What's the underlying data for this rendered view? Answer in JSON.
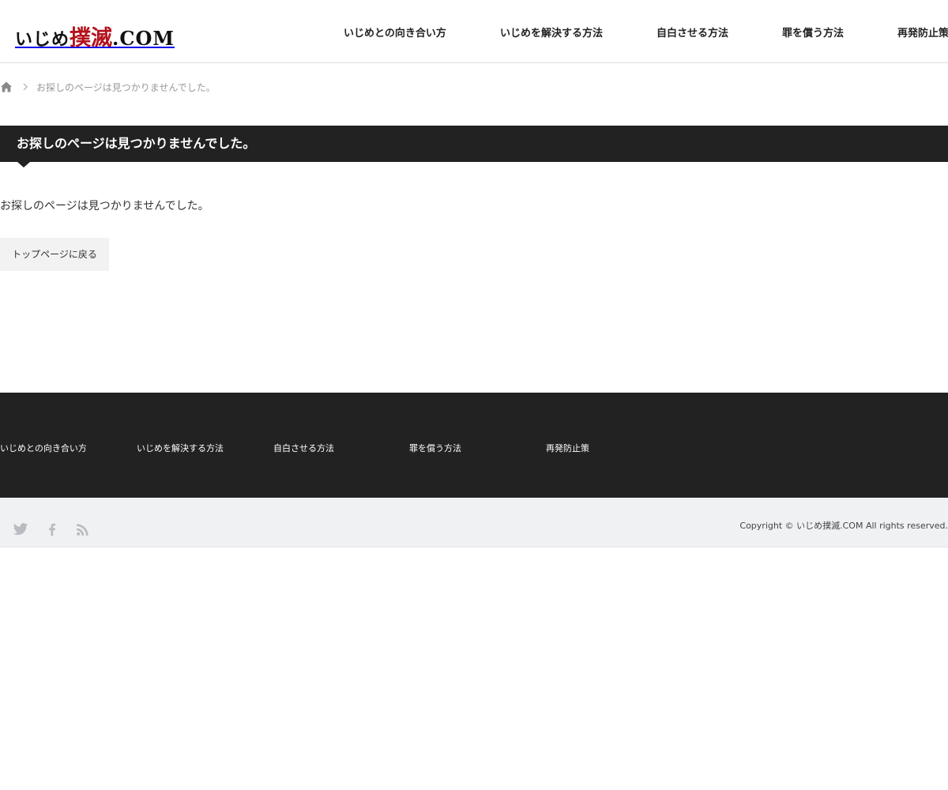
{
  "header": {
    "logo": {
      "part1": "いじめ",
      "part2": "撲滅",
      "part3": ".COM"
    },
    "nav": [
      {
        "label": "いじめとの向き合い方"
      },
      {
        "label": "いじめを解決する方法"
      },
      {
        "label": "自白させる方法"
      },
      {
        "label": "罪を償う方法"
      },
      {
        "label": "再発防止策"
      }
    ]
  },
  "breadcrumb": {
    "home_icon": "home-icon",
    "current": "お探しのページは見つかりませんでした。"
  },
  "main": {
    "headline": "お探しのページは見つかりませんでした。",
    "message": "お探しのページは見つかりませんでした。",
    "back_button": "トップページに戻る"
  },
  "footer": {
    "menu": [
      {
        "label": "いじめとの向き合い方"
      },
      {
        "label": "いじめを解決する方法"
      },
      {
        "label": "自白させる方法"
      },
      {
        "label": "罪を償う方法"
      },
      {
        "label": "再発防止策"
      }
    ],
    "social": [
      "twitter-icon",
      "facebook-icon",
      "rss-icon"
    ],
    "copyright": "Copyright ©  いじめ撲滅.COM All rights reserved."
  },
  "colors": {
    "header_bg": "#ffffff",
    "headline_bg": "#222222",
    "footer_menu_bg": "#222222",
    "footer_bottom_bg": "#f0f1f3",
    "logo_accent": "#b3121c",
    "button_bg": "#f2f2f2"
  }
}
